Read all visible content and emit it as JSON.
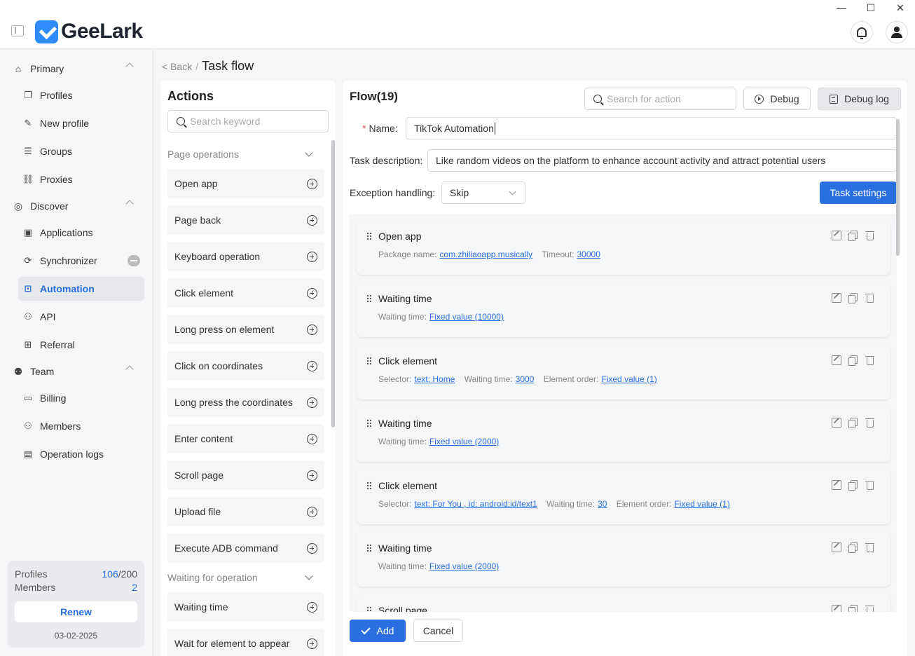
{
  "app": {
    "name": "GeeLark"
  },
  "window": {
    "minimize": "—",
    "maximize": "☐",
    "close": "✕"
  },
  "sidebar": {
    "sections": [
      {
        "label": "Primary",
        "icon": "home-icon"
      },
      {
        "label": "Discover",
        "icon": "planet-icon"
      },
      {
        "label": "Team",
        "icon": "team-icon"
      }
    ],
    "items": [
      {
        "label": "Profiles",
        "icon": "profiles-icon"
      },
      {
        "label": "New profile",
        "icon": "new-profile-icon"
      },
      {
        "label": "Groups",
        "icon": "groups-icon"
      },
      {
        "label": "Proxies",
        "icon": "proxies-icon"
      },
      {
        "label": "Applications",
        "icon": "applications-icon"
      },
      {
        "label": "Synchronizer",
        "icon": "synchronizer-icon"
      },
      {
        "label": "Automation",
        "icon": "automation-icon",
        "active": true
      },
      {
        "label": "API",
        "icon": "api-icon"
      },
      {
        "label": "Referral",
        "icon": "gift-icon"
      },
      {
        "label": "Billing",
        "icon": "billing-icon"
      },
      {
        "label": "Members",
        "icon": "members-icon"
      },
      {
        "label": "Operation logs",
        "icon": "logs-icon"
      }
    ],
    "quota": {
      "profiles_label": "Profiles",
      "profiles_used": "106",
      "profiles_total": "/200",
      "members_label": "Members",
      "members_value": "2",
      "renew_label": "Renew",
      "date": "03-02-2025"
    }
  },
  "breadcrumb": {
    "back": "< Back",
    "sep": "/",
    "title": "Task flow"
  },
  "actions": {
    "title": "Actions",
    "search_placeholder": "Search keyword",
    "groups": [
      {
        "label": "Page operations"
      },
      {
        "label": "Waiting for operation"
      }
    ],
    "items": [
      "Open app",
      "Page back",
      "Keyboard operation",
      "Click element",
      "Long press on element",
      "Click on coordinates",
      "Long press the coordinates",
      "Enter content",
      "Scroll page",
      "Upload file",
      "Execute ADB command"
    ],
    "wait_items": [
      "Waiting time",
      "Wait for element to appear"
    ]
  },
  "flow": {
    "title": "Flow(19)",
    "search_placeholder": "Search for action",
    "debug_label": "Debug",
    "debug_log_label": "Debug log",
    "name_required": "*",
    "name_label": "Name:",
    "name_value": "TikTok Automation",
    "desc_label": "Task description:",
    "desc_value": "Like random videos on the platform to enhance account activity and attract potential users",
    "exception_label": "Exception handling:",
    "exception_value": "Skip",
    "task_settings_label": "Task settings",
    "steps": [
      {
        "name": "Open app",
        "params": [
          [
            "Package name:",
            "com.zhiliaoapp.musically"
          ],
          [
            "Timeout:",
            "30000"
          ]
        ]
      },
      {
        "name": "Waiting time",
        "params": [
          [
            "Waiting time:",
            "Fixed value (10000)"
          ]
        ]
      },
      {
        "name": "Click element",
        "params": [
          [
            "Selector:",
            "text:  Home"
          ],
          [
            "Waiting time:",
            "3000"
          ],
          [
            "Element order:",
            "Fixed value (1)"
          ]
        ]
      },
      {
        "name": "Waiting time",
        "params": [
          [
            "Waiting time:",
            "Fixed value (2000)"
          ]
        ]
      },
      {
        "name": "Click element",
        "params": [
          [
            "Selector:",
            "text:  For You ,  id:  android:id/text1"
          ],
          [
            "Waiting time:",
            "30"
          ],
          [
            "Element order:",
            "Fixed value (1)"
          ]
        ]
      },
      {
        "name": "Waiting time",
        "params": [
          [
            "Waiting time:",
            "Fixed value (2000)"
          ]
        ]
      },
      {
        "name": "Scroll page",
        "params": []
      }
    ],
    "add_label": "Add",
    "cancel_label": "Cancel"
  },
  "colors": {
    "accent": "#2a6fe0",
    "required": "#e34d59",
    "background": "#f5f6f8"
  }
}
